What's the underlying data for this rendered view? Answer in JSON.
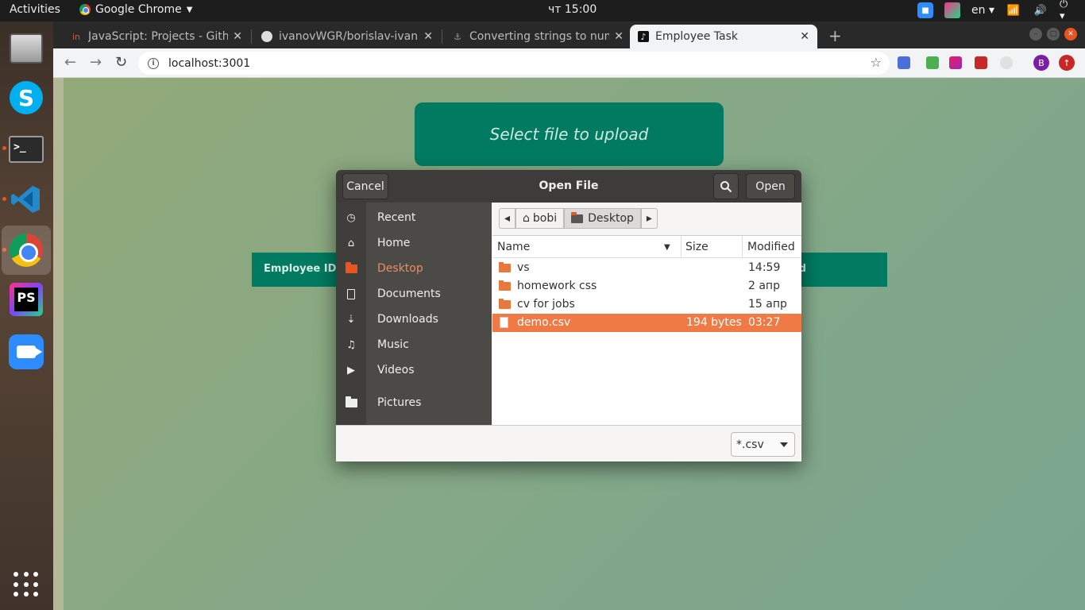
{
  "topbar": {
    "activities": "Activities",
    "app_name": "Google Chrome",
    "clock": "чт 15:00",
    "keyboard_layout": "en"
  },
  "dock": {
    "items": [
      "files",
      "skype",
      "terminal",
      "vscode",
      "chrome",
      "phpstorm",
      "zoom"
    ],
    "terminal_prompt": ">_",
    "phpstorm_label": "PS",
    "skype_label": "S"
  },
  "browser": {
    "tabs": [
      {
        "title": "JavaScript: Projects - Gith",
        "favicon": "in"
      },
      {
        "title": "ivanovWGR/borislav-ivan",
        "favicon": "github"
      },
      {
        "title": "Converting strings to num",
        "favicon": "mdn"
      },
      {
        "title": "Employee Task",
        "favicon": "react"
      }
    ],
    "url": "localhost:3001",
    "profile_initial": "B",
    "update_icon": "↑"
  },
  "page": {
    "upload_label": "Select file to upload",
    "header_left": "Employee ID #1",
    "header_right": "d"
  },
  "dialog": {
    "title": "Open File",
    "cancel": "Cancel",
    "open": "Open",
    "places": [
      {
        "label": "Recent",
        "icon": "clock-icon"
      },
      {
        "label": "Home",
        "icon": "home-icon"
      },
      {
        "label": "Desktop",
        "icon": "folder-icon"
      },
      {
        "label": "Documents",
        "icon": "document-icon"
      },
      {
        "label": "Downloads",
        "icon": "download-icon"
      },
      {
        "label": "Music",
        "icon": "music-icon"
      },
      {
        "label": "Videos",
        "icon": "video-icon"
      },
      {
        "label": "Pictures",
        "icon": "folder-icon"
      }
    ],
    "path": [
      "bobi",
      "Desktop"
    ],
    "columns": {
      "name": "Name",
      "size": "Size",
      "modified": "Modified"
    },
    "files": [
      {
        "name": "vs",
        "size": "",
        "modified": "14:59",
        "type": "folder"
      },
      {
        "name": "homework css",
        "size": "",
        "modified": "2 апр",
        "type": "folder"
      },
      {
        "name": "cv for jobs",
        "size": "",
        "modified": "15 апр",
        "type": "folder"
      },
      {
        "name": "demo.csv",
        "size": "194 bytes",
        "modified": "03:27",
        "type": "file"
      }
    ],
    "filter": "*.csv"
  },
  "colors": {
    "accent": "#e95420",
    "page_button": "#007a60",
    "selection": "#ef7a45"
  }
}
